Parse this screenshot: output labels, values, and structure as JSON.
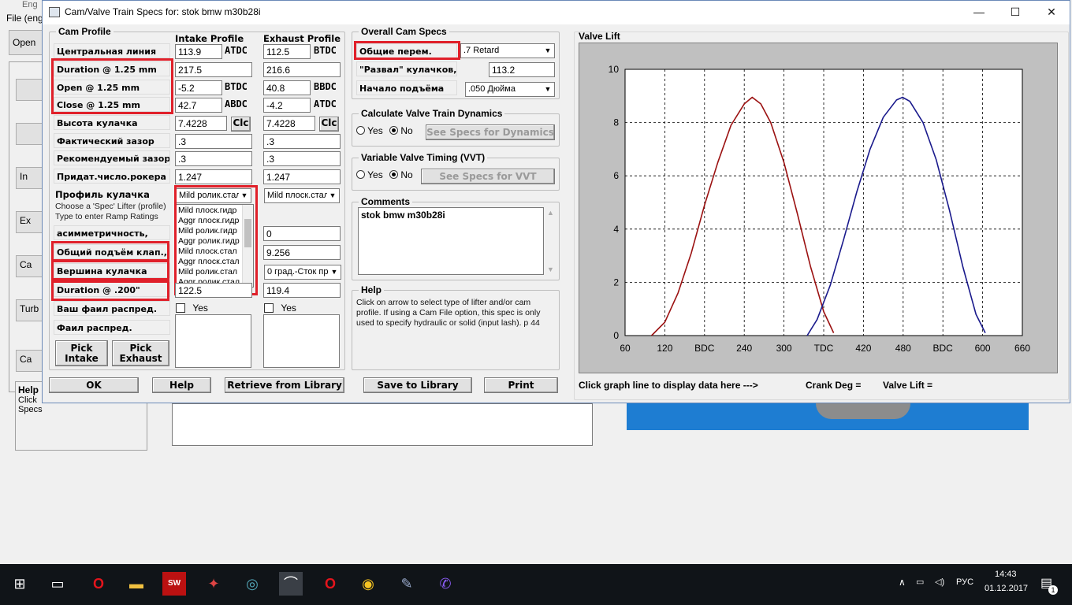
{
  "background_app": {
    "title": "Eng",
    "menu": "File (eng",
    "open_label": "Open",
    "side_buttons": [
      "In",
      "Ex",
      "Ca",
      "Turb",
      "Ca"
    ],
    "help_title": "Help",
    "help_text_1": "Click",
    "help_text_2": "Specs"
  },
  "dialog": {
    "title": "Cam/Valve Train Specs for:  stok bmw m30b28i",
    "minimize": "—",
    "maximize": "☐",
    "close": "✕"
  },
  "cam_profile": {
    "group_label": "Cam Profile",
    "intake_header": "Intake Profile",
    "exhaust_header": "Exhaust Profile",
    "rows": {
      "centerline": {
        "label": "Центральная линия",
        "intake": "113.9",
        "intake_unit": "ATDC",
        "exhaust": "112.5",
        "exhaust_unit": "BTDC"
      },
      "duration": {
        "label": "Duration @ 1.25 mm",
        "intake": "217.5",
        "exhaust": "216.6"
      },
      "open": {
        "label": "Open @ 1.25 mm",
        "intake": "-5.2",
        "intake_unit": "BTDC",
        "exhaust": "40.8",
        "exhaust_unit": "BBDC"
      },
      "close": {
        "label": "Close @ 1.25 mm",
        "intake": "42.7",
        "intake_unit": "ABDC",
        "exhaust": "-4.2",
        "exhaust_unit": "ATDC"
      },
      "lobe_height": {
        "label": "Высота кулачка",
        "intake": "7.4228",
        "exhaust": "7.4228",
        "clc": "Clc"
      },
      "actual_lash": {
        "label": "Фактический зазор",
        "intake": ".3",
        "exhaust": ".3"
      },
      "recommended_lash": {
        "label": "Рекомендуемый зазор",
        "intake": ".3",
        "exhaust": ".3"
      },
      "rocker_ratio": {
        "label": "Придат.число.рокера",
        "intake": "1.247",
        "exhaust": "1.247"
      },
      "lifter_profile": {
        "label": "Профиль кулачка",
        "intake": "Mild ролик.стал",
        "exhaust": "Mild плоск.стал"
      },
      "asymmetry": {
        "label": "асимметричность,",
        "exhaust": "0"
      },
      "total_lift": {
        "label": "Общий подъём клап.,",
        "exhaust": "9.256"
      },
      "lobe_top": {
        "label": "Вершина кулачка",
        "exhaust": "0 град.-Сток пр"
      },
      "duration_200": {
        "label": "Duration @ .200\"",
        "intake": "122.5",
        "exhaust": "119.4"
      },
      "your_cam_file": {
        "label": "Ваш фаил распред.",
        "intake_check": "Yes",
        "exhaust_check": "Yes"
      },
      "cam_file": {
        "label": "Фаил распред."
      }
    },
    "hint_1": "Choose a 'Spec' Lifter (profile)",
    "hint_2": "Type to enter Ramp Ratings",
    "lifter_options": [
      "Mild плоск.гидр",
      "Aggr плоск.гидр",
      "Mild ролик.гидр",
      "Aggr ролик.гидр",
      "Mild плоск.стал",
      "Aggr плоск.стал",
      "Mild ролик.стал",
      "Aggr ролик.стал"
    ],
    "pick_intake": [
      "Pick",
      "Intake"
    ],
    "pick_exhaust": [
      "Pick",
      "Exhaust"
    ]
  },
  "overall": {
    "group_label": "Overall Cam Specs",
    "common_label": "Общие перем.",
    "common_value": ".7 Retard",
    "lsa_label": "\"Развал\" кулачков,",
    "lsa_value": "113.2",
    "lift_start_label": "Начало подъёма",
    "lift_start_value": ".050 Дюйма"
  },
  "dynamics": {
    "group_label": "Calculate Valve Train Dynamics",
    "yes": "Yes",
    "no": "No",
    "button": "See Specs for Dynamics"
  },
  "vvt": {
    "group_label": "Variable Valve Timing (VVT)",
    "yes": "Yes",
    "no": "No",
    "button": "See Specs for VVT"
  },
  "comments": {
    "group_label": "Comments",
    "text": "stok bmw m30b28i"
  },
  "help": {
    "group_label": "Help",
    "text": "Click on arrow to select type of lifter and/or cam profile.  If using a Cam File option, this spec is only used to specify hydraulic or solid (input lash).  p 44"
  },
  "buttons": {
    "ok": "OK",
    "help": "Help",
    "retrieve": "Retrieve from Library",
    "save": "Save to Library",
    "print": "Print"
  },
  "graph": {
    "group_label": "Valve Lift",
    "status": "Click graph line to display data here --->",
    "crank_label": "Crank Deg =",
    "lift_label": "Valve Lift =",
    "intake_color": "#9b1111",
    "exhaust_color": "#1a1a8c"
  },
  "chart_data": {
    "type": "line",
    "title": "Valve Lift",
    "xlabel": "",
    "ylabel": "",
    "x_ticks": [
      "60",
      "120",
      "BDC",
      "240",
      "300",
      "TDC",
      "420",
      "480",
      "BDC",
      "600",
      "660"
    ],
    "y_ticks": [
      "0",
      "2",
      "4",
      "6",
      "8",
      "10"
    ],
    "xlim": [
      60,
      660
    ],
    "ylim": [
      0,
      10
    ],
    "grid": true,
    "series": [
      {
        "color": "#9b1111",
        "x": [
          100,
          120,
          140,
          160,
          180,
          200,
          220,
          240,
          252,
          265,
          280,
          300,
          320,
          340,
          360,
          375
        ],
        "y": [
          0,
          0.5,
          1.6,
          3.1,
          4.9,
          6.5,
          7.9,
          8.7,
          8.95,
          8.7,
          8.0,
          6.5,
          4.6,
          2.6,
          0.9,
          0.1
        ]
      },
      {
        "color": "#1a1a8c",
        "x": [
          335,
          350,
          370,
          390,
          410,
          430,
          450,
          470,
          479,
          490,
          510,
          530,
          550,
          570,
          590,
          604
        ],
        "y": [
          0,
          0.6,
          1.9,
          3.6,
          5.4,
          7.0,
          8.2,
          8.85,
          8.95,
          8.8,
          8.0,
          6.6,
          4.7,
          2.6,
          0.8,
          0.1
        ]
      }
    ]
  },
  "taskbar": {
    "lang": "РУС",
    "time": "14:43",
    "date": "01.12.2017",
    "notify_count": "1"
  }
}
